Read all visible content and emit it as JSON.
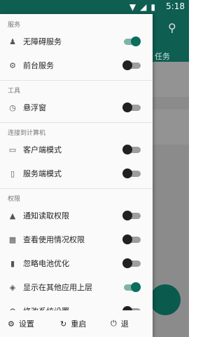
{
  "status_bar": {
    "time": "5:18"
  },
  "background": {
    "tab_label": "任务"
  },
  "sections": {
    "service": "服务",
    "tools": "工具",
    "connect": "连接到计算机",
    "permissions": "权限"
  },
  "items": {
    "accessibility": {
      "label": "无障碍服务",
      "icon": "accessibility-icon",
      "on": true
    },
    "foreground": {
      "label": "前台服务",
      "icon": "gears-icon",
      "on": false
    },
    "floating": {
      "label": "悬浮窗",
      "icon": "timer-icon",
      "on": false
    },
    "client": {
      "label": "客户端模式",
      "icon": "laptop-icon",
      "on": false
    },
    "server": {
      "label": "服务端模式",
      "icon": "phone-icon",
      "on": false
    },
    "notification": {
      "label": "通知读取权限",
      "icon": "bell-icon",
      "on": false
    },
    "usage": {
      "label": "查看使用情况权限",
      "icon": "chart-icon",
      "on": false
    },
    "battery": {
      "label": "忽略电池优化",
      "icon": "battery-icon",
      "on": false
    },
    "overlay": {
      "label": "显示在其他应用上层",
      "icon": "layers-icon",
      "on": true
    },
    "system": {
      "label": "修改系统设置",
      "icon": "settings-icon",
      "on": false
    }
  },
  "footer": {
    "settings": "设置",
    "restart": "重启",
    "exit": "退"
  },
  "colors": {
    "primary": "#0f5e52",
    "switch_on": "#0b6e5c"
  }
}
